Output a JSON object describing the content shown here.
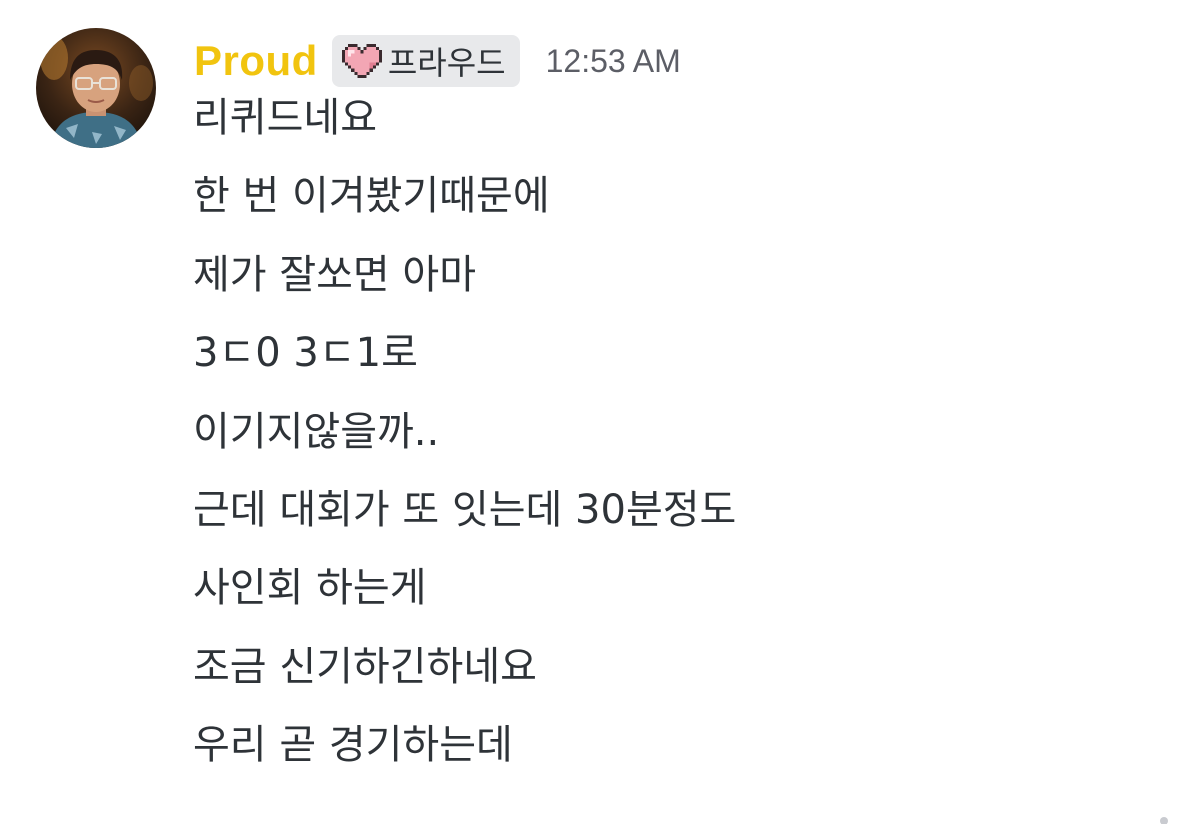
{
  "message": {
    "author": {
      "name": "Proud",
      "name_color": "#f1c40f",
      "avatar_icon": "user-photo-avatar"
    },
    "badge": {
      "icon": "pixel-heart-icon",
      "label": "프라우드"
    },
    "timestamp": "12:53 AM",
    "lines": [
      "리퀴드네요",
      "한 번 이겨봤기때문에",
      "제가 잘쏘면 아마",
      "3ㄷ0 3ㄷ1로",
      "이기지않을까..",
      "근데 대회가 또 잇는데 30분정도",
      "사인회 하는게",
      "조금 신기하긴하네요",
      "우리 곧 경기하는데"
    ]
  }
}
